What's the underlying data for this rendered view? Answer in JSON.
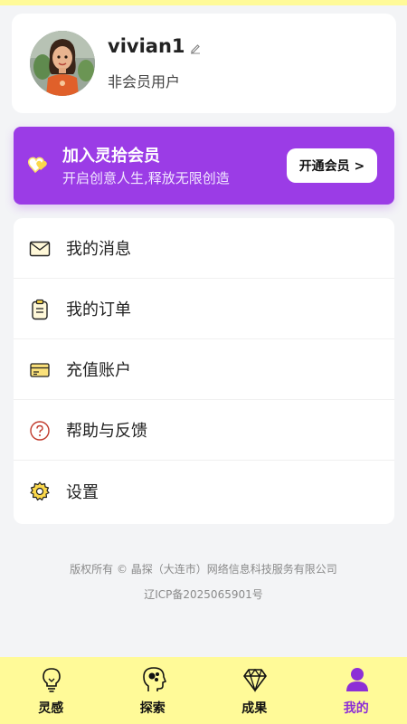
{
  "profile": {
    "username": "vivian1",
    "member_status": "非会员用户"
  },
  "vip_banner": {
    "title": "加入灵拾会员",
    "subtitle": "开启创意人生,释放无限创造",
    "button_label": "开通会员 >"
  },
  "menu": {
    "items": [
      {
        "label": "我的消息",
        "icon": "mail-icon"
      },
      {
        "label": "我的订单",
        "icon": "order-clipboard-icon"
      },
      {
        "label": "充值账户",
        "icon": "card-icon"
      },
      {
        "label": "帮助与反馈",
        "icon": "help-icon"
      },
      {
        "label": "设置",
        "icon": "gear-icon"
      }
    ]
  },
  "footer": {
    "copyright": "版权所有 © 晶探（大连市）网络信息科技服务有限公司",
    "icp": "辽ICP备2025065901号"
  },
  "bottom_nav": {
    "tabs": [
      {
        "label": "灵感",
        "icon": "lightbulb-icon"
      },
      {
        "label": "探索",
        "icon": "head-explore-icon"
      },
      {
        "label": "成果",
        "icon": "diamond-icon"
      },
      {
        "label": "我的",
        "icon": "user-icon",
        "active": true
      }
    ]
  },
  "colors": {
    "accent_purple": "#9b3ce6",
    "nav_yellow": "#fffa98",
    "background": "#f3f4f6"
  }
}
